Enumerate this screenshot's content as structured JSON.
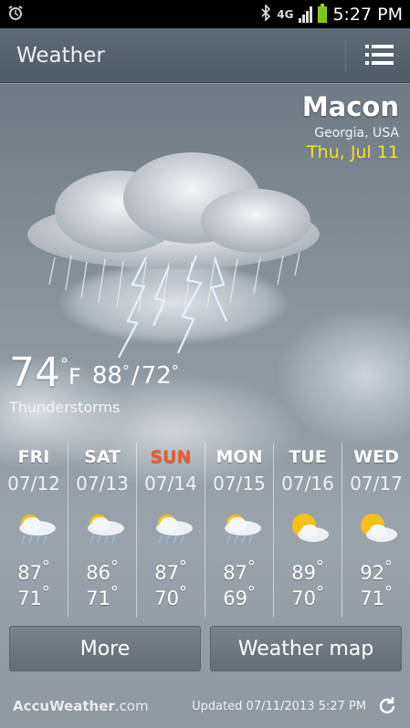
{
  "status_bar": {
    "time": "5:27 PM",
    "network": "4G",
    "icons": [
      "alarm-icon",
      "bluetooth-icon",
      "signal-icon",
      "battery-icon"
    ]
  },
  "app_bar": {
    "title": "Weather",
    "menu_icon": "list-menu-icon"
  },
  "location": {
    "city": "Macon",
    "region": "Georgia, USA",
    "date": "Thu, Jul 11"
  },
  "current": {
    "temp": "74",
    "unit": "F",
    "high": "88",
    "low": "72",
    "condition": "Thunderstorms",
    "icon": "thunderstorm-cloud-icon"
  },
  "forecast": [
    {
      "day": "FRI",
      "date": "07/12",
      "icon": "thunderstorm-sun-icon",
      "high": "87",
      "low": "71",
      "today": false
    },
    {
      "day": "SAT",
      "date": "07/13",
      "icon": "thunderstorm-sun-icon",
      "high": "86",
      "low": "71",
      "today": false
    },
    {
      "day": "SUN",
      "date": "07/14",
      "icon": "thunderstorm-sun-icon",
      "high": "87",
      "low": "70",
      "today": true
    },
    {
      "day": "MON",
      "date": "07/15",
      "icon": "thunderstorm-sun-icon",
      "high": "87",
      "low": "69",
      "today": false
    },
    {
      "day": "TUE",
      "date": "07/16",
      "icon": "partly-cloudy-icon",
      "high": "89",
      "low": "70",
      "today": false
    },
    {
      "day": "WED",
      "date": "07/17",
      "icon": "partly-cloudy-icon",
      "high": "92",
      "low": "71",
      "today": false
    }
  ],
  "buttons": {
    "more": "More",
    "weather_map": "Weather map"
  },
  "footer": {
    "brand_main": "AccuWeather",
    "brand_suffix": ".com",
    "updated": "Updated 07/11/2013 5:27 PM"
  },
  "colors": {
    "today_highlight": "#f05a28",
    "date_yellow": "#f0e020"
  }
}
